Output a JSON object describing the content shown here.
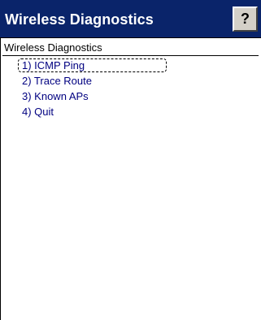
{
  "window": {
    "title": "Wireless Diagnostics",
    "help_label": "?"
  },
  "main": {
    "heading": "Wireless Diagnostics",
    "menu": [
      {
        "label": "1) ICMP Ping",
        "selected": true
      },
      {
        "label": "2) Trace Route",
        "selected": false
      },
      {
        "label": "3) Known APs",
        "selected": false
      },
      {
        "label": "4) Quit",
        "selected": false
      }
    ]
  },
  "colors": {
    "titlebar": "#0a246a",
    "menu_text": "#000080"
  }
}
